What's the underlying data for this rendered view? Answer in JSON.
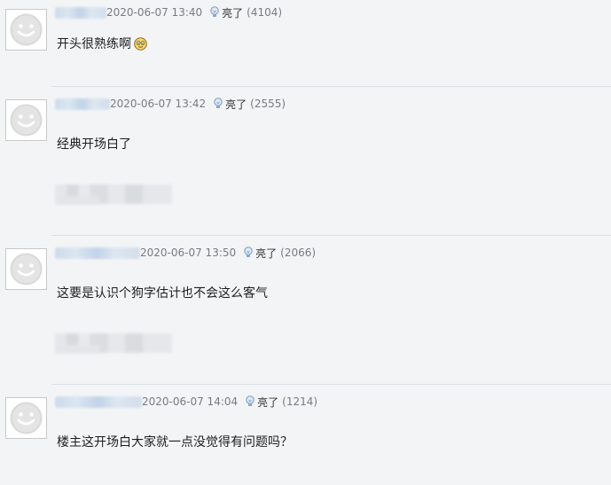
{
  "icons": {
    "avatar": "default-smiley-avatar-icon",
    "light": "lightbulb-icon",
    "emoji": "smiling-emoji-icon"
  },
  "colors": {
    "background": "#f3f4f6",
    "meta_text": "#777b80",
    "username_blur": "#c9d9ea"
  },
  "comments": [
    {
      "time": "2020-06-07 13:40",
      "light_label": "亮了",
      "light_count": "(4104)",
      "content": "开头很熟练啊",
      "has_emoji": true,
      "has_quote": false
    },
    {
      "time": "2020-06-07 13:42",
      "light_label": "亮了",
      "light_count": "(2555)",
      "content": "经典开场白了",
      "has_emoji": false,
      "has_quote": true
    },
    {
      "time": "2020-06-07 13:50",
      "light_label": "亮了",
      "light_count": "(2066)",
      "content": "这要是认识个狗字估计也不会这么客气",
      "has_emoji": false,
      "has_quote": true
    },
    {
      "time": "2020-06-07 14:04",
      "light_label": "亮了",
      "light_count": "(1214)",
      "content": "楼主这开场白大家就一点没觉得有问题吗？",
      "has_emoji": false,
      "has_quote": false
    }
  ]
}
